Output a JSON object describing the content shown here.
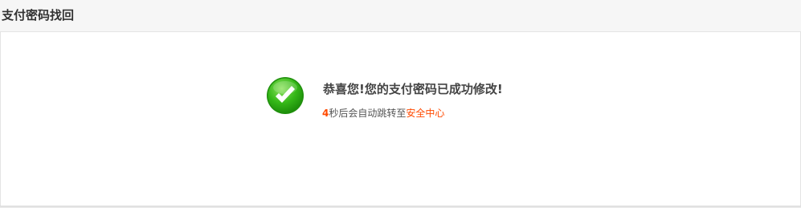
{
  "header": {
    "title": "支付密码找回"
  },
  "result": {
    "message": "恭喜您!您的支付密码已成功修改!",
    "icon": "check-circle-icon",
    "icon_color": "#2fb312",
    "redirect": {
      "seconds": "4",
      "text": "秒后会自动跳转至",
      "link_label": "安全中心",
      "link_color": "#ff4a00"
    }
  }
}
